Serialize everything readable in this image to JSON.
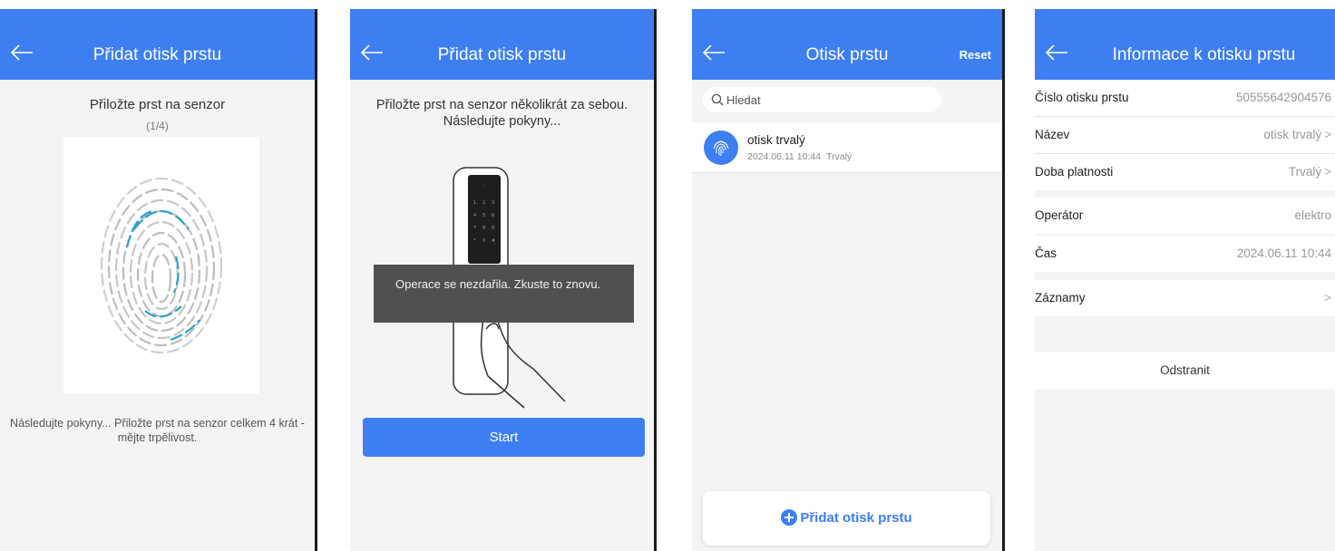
{
  "colors": {
    "accent": "#3d7ff2",
    "background": "#f4f4f4",
    "toast": "#505050"
  },
  "screen1": {
    "title": "Přidat otisk prstu",
    "instruction": "Přiložte prst na senzor",
    "counter": "(1/4)",
    "hint": "Následujte pokyny... Přiložte prst na senzor celkem 4 krát - mějte trpělivost."
  },
  "screen2": {
    "title": "Přidat otisk prstu",
    "instruction": "Přiložte prst na senzor několikrát za sebou. Následujte pokyny...",
    "toast": "Operace se nezdařila. Zkuste to znovu.",
    "start_button": "Start"
  },
  "screen3": {
    "title": "Otisk prstu",
    "reset": "Reset",
    "search_placeholder": "Hledat",
    "items": [
      {
        "name": "otisk trvalý",
        "date": "2024.06.11 10:44",
        "type": "Trvalý"
      }
    ],
    "add_button": "Přidat otisk prstu"
  },
  "screen4": {
    "title": "Informace k otisku prstu",
    "fields": [
      {
        "label": "Číslo otisku prstu",
        "value": "50555642904576"
      },
      {
        "label": "Název",
        "value": "otisk trvalý"
      },
      {
        "label": "Doba platnosti",
        "value": "Trvalý"
      },
      {
        "label": "Operátor",
        "value": "elektro"
      },
      {
        "label": "Čas",
        "value": "2024.06.11 10:44"
      },
      {
        "label": "Záznamy",
        "value": ""
      }
    ],
    "chevron": ">",
    "delete": "Odstranit"
  },
  "icons": [
    "back-arrow-icon",
    "fingerprint-icon",
    "search-icon",
    "plus-circle-icon",
    "chevron-right-icon"
  ]
}
